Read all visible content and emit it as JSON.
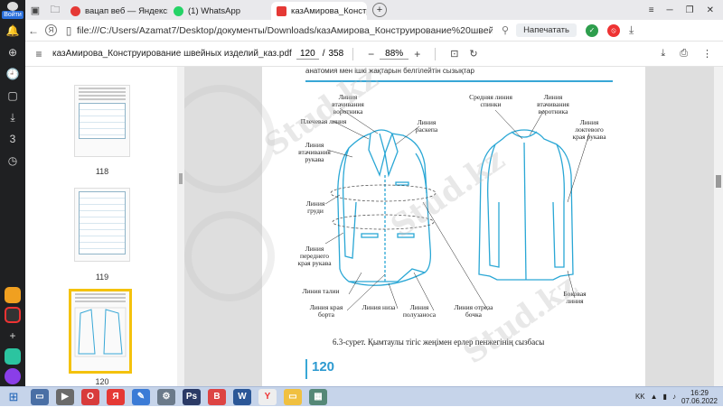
{
  "sidebar": {
    "profile_label": "Войти"
  },
  "tabs": [
    {
      "label": "вацап веб — Яндекс: наш",
      "color": "#e53935"
    },
    {
      "label": "(1) WhatsApp",
      "color": "#25d366"
    },
    {
      "label": "казАмирова_Конструир",
      "color": "#e53935",
      "active": true
    }
  ],
  "address": {
    "url": "file:///C:/Users/Azamat7/Desktop/документы/Downloads/казАмирова_Конструирование%20швейных%2...",
    "print_label": "Напечатать"
  },
  "pdf": {
    "title": "казАмирова_Конструирование швейных изделий_каз.pdf",
    "page_current": "120",
    "page_total": "358",
    "zoom": "88%"
  },
  "thumbnails": [
    {
      "label": "118"
    },
    {
      "label": "119"
    },
    {
      "label": "120"
    }
  ],
  "page": {
    "top_text": "анатомия мен ішкі жақтарын белгілейтін сызықтар",
    "caption": "6.3-сурет. Қымтаулы тігіс жеңімен ерлер пенжегінің сызбасы",
    "page_number": "120",
    "labels": {
      "l1": "Линия втачивания воротника",
      "l2": "Плечевая линия",
      "l3": "Линия раскепа",
      "l4": "Линия втачивания рукава",
      "l5": "Линия груди",
      "l6": "Линия переднего края рукава",
      "l7": "Линия талии",
      "l8": "Линия края борта",
      "l9": "Линия низа",
      "l10": "Линия полузаноса",
      "l11": "Линия отреза бочка",
      "l12": "Средняя линия спинки",
      "l13": "Линия втачивания воротника",
      "l14": "Линия локтевого края рукава",
      "l15": "Боковая линия"
    }
  },
  "watermark": "Stud.kz",
  "taskbar": {
    "lang": "KK",
    "time": "16:29",
    "date": "07.06.2022"
  }
}
